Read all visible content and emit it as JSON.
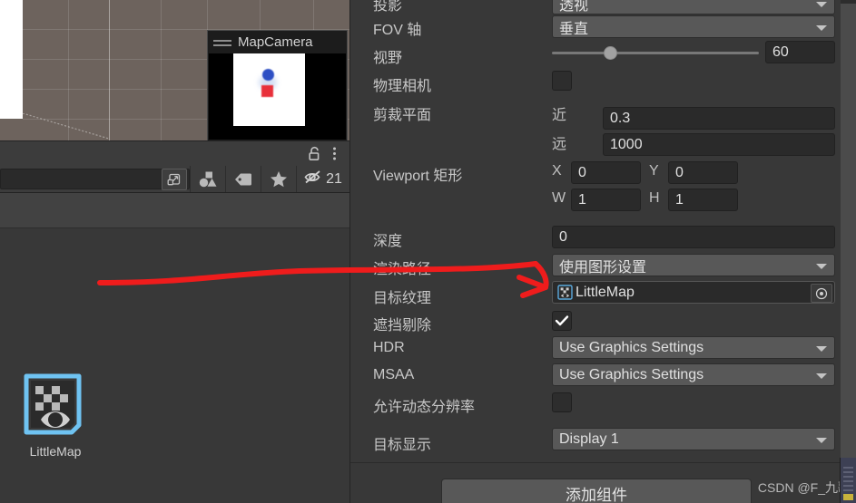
{
  "scene_view": {
    "name": "scene-viewport"
  },
  "map_camera_preview": {
    "title": "MapCamera",
    "drag_handle_icon": "drag-handle-icon",
    "render_contents": [
      "blue-sphere",
      "red-cube"
    ]
  },
  "project_panel": {
    "lock_icon": "lock-icon",
    "menu_icon": "kebab-menu-icon",
    "search": {
      "value": "",
      "placeholder": ""
    },
    "search_expand_icon": "search-expand-icon",
    "filter_buttons": [
      {
        "icon": "shapes-filter-icon",
        "name": "filter-by-type-button"
      },
      {
        "icon": "label-tag-icon",
        "name": "filter-by-label-button"
      },
      {
        "icon": "star-favorite-icon",
        "name": "filter-favorites-button"
      }
    ],
    "hidden_items": {
      "icon": "eye-crossed-icon",
      "count": "21"
    },
    "assets": [
      {
        "name": "LittleMap",
        "icon": "render-texture-icon",
        "selected": true
      }
    ]
  },
  "inspector": {
    "rows": [
      {
        "label": "投影",
        "control": "dropdown",
        "value": "透视",
        "name": "projection"
      },
      {
        "label": "FOV 轴",
        "control": "dropdown",
        "value": "垂直",
        "name": "fov-axis"
      },
      {
        "label": "视野",
        "control": "slider",
        "value": "60",
        "slider_percent": 28,
        "name": "field-of-view"
      },
      {
        "label": "物理相机",
        "control": "checkbox",
        "checked": false,
        "name": "physical-camera"
      },
      {
        "label": "剪裁平面",
        "control": "two-fields",
        "sub_a_label": "近",
        "sub_a_value": "0.3",
        "sub_b_label": "远",
        "sub_b_value": "1000",
        "name": "clipping-planes"
      },
      {
        "label": "Viewport 矩形",
        "control": "rect",
        "x_label": "X",
        "x_value": "0",
        "y_label": "Y",
        "y_value": "0",
        "w_label": "W",
        "w_value": "1",
        "h_label": "H",
        "h_value": "1",
        "name": "viewport-rect"
      },
      {
        "label": "深度",
        "control": "numfield",
        "value": "0",
        "name": "depth"
      },
      {
        "label": "渲染路径",
        "control": "dropdown",
        "value": "使用图形设置",
        "name": "rendering-path"
      },
      {
        "label": "目标纹理",
        "control": "objectfield",
        "value": "LittleMap",
        "icon": "render-texture-icon",
        "picker_icon": "object-picker-icon",
        "name": "target-texture"
      },
      {
        "label": "遮挡剔除",
        "control": "checkbox",
        "checked": true,
        "name": "occlusion-culling"
      },
      {
        "label": "HDR",
        "control": "dropdown",
        "value": "Use Graphics Settings",
        "name": "hdr"
      },
      {
        "label": "MSAA",
        "control": "dropdown",
        "value": "Use Graphics Settings",
        "name": "msaa"
      },
      {
        "label": "允许动态分辨率",
        "control": "checkbox",
        "checked": false,
        "name": "allow-dynamic-resolution"
      },
      {
        "label": "目标显示",
        "control": "dropdown",
        "value": "Display 1",
        "name": "target-display"
      }
    ],
    "add_component_label": "添加组件"
  },
  "watermark": {
    "text": "CSDN @F_九歌"
  },
  "annotation": {
    "arrow_color": "#ef1c1c",
    "description": "arrow-from-littlemap-asset-to-target-texture"
  },
  "colors": {
    "panel_bg": "#383838",
    "field_bg": "#2a2a2a",
    "dropdown_bg": "#585858",
    "text": "#c8c8c8",
    "selection_blue": "#6fc3f2",
    "accent_red": "#ef1c1c"
  }
}
